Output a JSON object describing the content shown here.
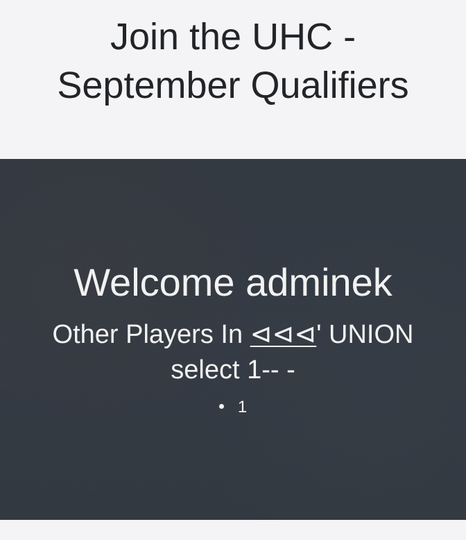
{
  "header": {
    "title_line1": "Join the UHC -",
    "title_line2": "September Qualifiers"
  },
  "hero": {
    "welcome": "Welcome adminek",
    "players_heading_prefix": "Other Players In ",
    "players_heading_symbols": "⊲⊲⊲",
    "players_heading_suffix": "' UNION",
    "players_heading_line2": "select 1-- -",
    "players": [
      "1"
    ]
  }
}
